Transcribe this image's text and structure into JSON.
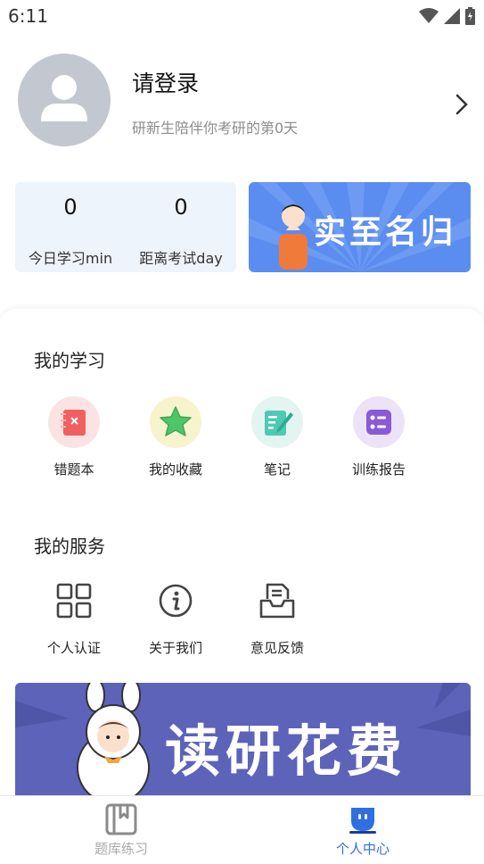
{
  "status_bar": {
    "time": "6:11"
  },
  "profile": {
    "title": "请登录",
    "subtitle": "研新生陪伴你考研的第0天"
  },
  "stats": [
    {
      "value": "0",
      "label": "今日学习min"
    },
    {
      "value": "0",
      "label": "距离考试day"
    }
  ],
  "promo": {
    "text": "实至名归"
  },
  "my_study": {
    "title": "我的学习",
    "items": [
      {
        "label": "错题本",
        "icon": "wrong-notebook-icon",
        "bg": "#fbe3e3",
        "color": "#f06060"
      },
      {
        "label": "我的收藏",
        "icon": "star-icon",
        "bg": "#f7f3cc",
        "color": "#4fc46a"
      },
      {
        "label": "笔记",
        "icon": "note-edit-icon",
        "bg": "#e2f5f0",
        "color": "#4fc9b1"
      },
      {
        "label": "训练报告",
        "icon": "report-list-icon",
        "bg": "#ece3f8",
        "color": "#8a5ad6"
      }
    ]
  },
  "my_service": {
    "title": "我的服务",
    "items": [
      {
        "label": "个人认证",
        "icon": "grid-apps-icon"
      },
      {
        "label": "关于我们",
        "icon": "info-icon"
      },
      {
        "label": "意见反馈",
        "icon": "feedback-tray-icon"
      }
    ]
  },
  "bottom_banner": {
    "text": "读研花费"
  },
  "tabs": [
    {
      "label": "题库练习",
      "icon": "question-bank-icon",
      "active": false
    },
    {
      "label": "个人中心",
      "icon": "personal-center-icon",
      "active": true
    }
  ],
  "colors": {
    "accent": "#2f6fe0",
    "inactive_tab": "#a9a9a9",
    "stats_bg": "#eef4fc",
    "promo_bg": "#5b8df0",
    "banner_bg": "#5c63b9"
  }
}
